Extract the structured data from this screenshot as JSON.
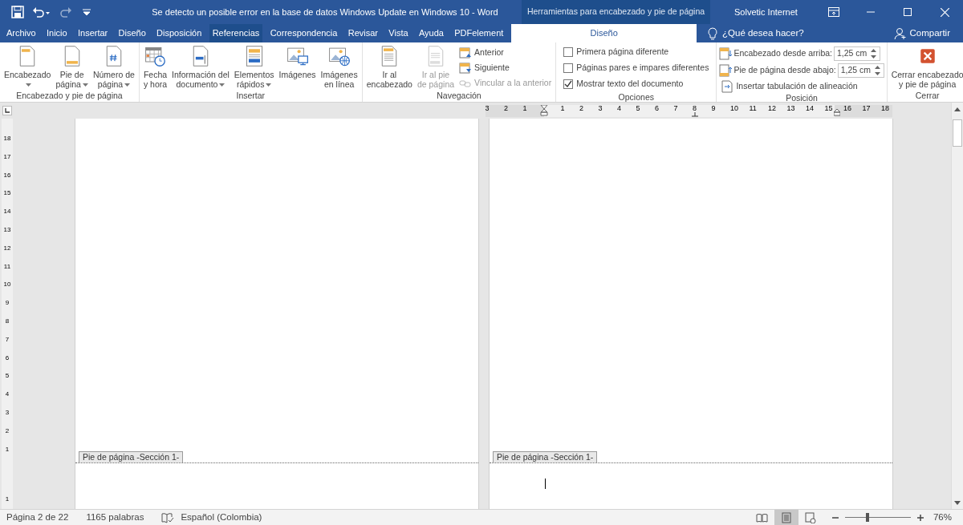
{
  "title_bar": {
    "quick_access": [
      {
        "kind": "save",
        "disabled": false
      },
      {
        "kind": "undo",
        "disabled": false
      },
      {
        "kind": "redo",
        "disabled": true
      },
      {
        "kind": "customize",
        "disabled": false
      }
    ],
    "title": "Se detecto un posible error en la base de datos Windows Update en Windows 10  -  Word",
    "context_title": "Herramientas para encabezado y pie de página",
    "user": "Solvetic Internet"
  },
  "tabs": [
    {
      "label": "Archivo",
      "selected": false,
      "hovered": false,
      "contextual": false
    },
    {
      "label": "Inicio",
      "selected": false,
      "hovered": false,
      "contextual": false
    },
    {
      "label": "Insertar",
      "selected": false,
      "hovered": false,
      "contextual": false
    },
    {
      "label": "Diseño",
      "selected": false,
      "hovered": false,
      "contextual": false
    },
    {
      "label": "Disposición",
      "selected": false,
      "hovered": false,
      "contextual": false
    },
    {
      "label": "Referencias",
      "selected": false,
      "hovered": true,
      "contextual": false
    },
    {
      "label": "Correspondencia",
      "selected": false,
      "hovered": false,
      "contextual": false
    },
    {
      "label": "Revisar",
      "selected": false,
      "hovered": false,
      "contextual": false
    },
    {
      "label": "Vista",
      "selected": false,
      "hovered": false,
      "contextual": false
    },
    {
      "label": "Ayuda",
      "selected": false,
      "hovered": false,
      "contextual": false
    },
    {
      "label": "PDFelement",
      "selected": false,
      "hovered": false,
      "contextual": false
    },
    {
      "label": "Diseño",
      "selected": true,
      "hovered": false,
      "contextual": true
    }
  ],
  "tell_me": {
    "placeholder": "¿Qué desea hacer?"
  },
  "share": "Compartir",
  "ribbon_groups": [
    {
      "label": "Encabezado y pie de página",
      "items": [
        {
          "kind": "large",
          "lines": [
            "Encabezado"
          ],
          "dropdown": true,
          "disabled": false
        },
        {
          "kind": "large",
          "lines": [
            "Pie de",
            "página"
          ],
          "dropdown": true,
          "disabled": false
        },
        {
          "kind": "large",
          "lines": [
            "Número de",
            "página"
          ],
          "dropdown": true,
          "disabled": false
        }
      ]
    },
    {
      "label": "Insertar",
      "items": [
        {
          "kind": "large",
          "lines": [
            "Fecha",
            "y hora"
          ],
          "dropdown": false,
          "disabled": false
        },
        {
          "kind": "large",
          "lines": [
            "Información del",
            "documento"
          ],
          "dropdown": true,
          "disabled": false
        },
        {
          "kind": "large",
          "lines": [
            "Elementos",
            "rápidos"
          ],
          "dropdown": true,
          "disabled": false
        },
        {
          "kind": "large",
          "lines": [
            "Imágenes"
          ],
          "dropdown": false,
          "disabled": false
        },
        {
          "kind": "large",
          "lines": [
            "Imágenes",
            "en línea"
          ],
          "dropdown": false,
          "disabled": false
        }
      ]
    },
    {
      "label": "Navegación",
      "items": [
        {
          "kind": "large",
          "lines": [
            "Ir al",
            "encabezado"
          ],
          "dropdown": false,
          "disabled": false
        },
        {
          "kind": "large",
          "lines": [
            "Ir al pie",
            "de página"
          ],
          "dropdown": false,
          "disabled": true
        },
        {
          "kind": "small",
          "label": "Anterior",
          "disabled": false
        },
        {
          "kind": "small",
          "label": "Siguiente",
          "disabled": false
        },
        {
          "kind": "small",
          "label": "Vincular a la anterior",
          "disabled": true
        }
      ]
    },
    {
      "label": "Opciones",
      "items": [
        {
          "kind": "checkbox",
          "label": "Primera página diferente",
          "checked": false
        },
        {
          "kind": "checkbox",
          "label": "Páginas pares e impares diferentes",
          "checked": false
        },
        {
          "kind": "checkbox",
          "label": "Mostrar texto del documento",
          "checked": true
        }
      ]
    },
    {
      "label": "Posición",
      "items": [
        {
          "kind": "spinner",
          "label": "Encabezado desde arriba:",
          "value": "1,25 cm"
        },
        {
          "kind": "spinner",
          "label": "Pie de página desde abajo:",
          "value": "1,25 cm"
        },
        {
          "kind": "small",
          "label": "Insertar tabulación de alineación",
          "disabled": false
        }
      ]
    },
    {
      "label": "Cerrar",
      "items": [
        {
          "kind": "large",
          "lines": [
            "Cerrar encabezado",
            "y pie de página"
          ],
          "dropdown": false,
          "disabled": false
        }
      ]
    }
  ],
  "horizontal_ruler": [
    "3",
    "2",
    "1",
    "1",
    "2",
    "3",
    "4",
    "5",
    "6",
    "7",
    "8",
    "9",
    "10",
    "11",
    "12",
    "13",
    "14",
    "15",
    "16",
    "17",
    "18"
  ],
  "vertical_ruler": [
    "18",
    "17",
    "16",
    "15",
    "14",
    "13",
    "12",
    "11",
    "10",
    "9",
    "8",
    "7",
    "6",
    "5",
    "4",
    "3",
    "2",
    "1",
    "1"
  ],
  "pages": [
    {
      "footer_label": "Pie de página -Sección 1-",
      "cursor": false
    },
    {
      "footer_label": "Pie de página -Sección 1-",
      "cursor": true
    }
  ],
  "status_bar": {
    "page": "Página 2 de 22",
    "words": "1165 palabras",
    "language": "Español (Colombia)",
    "views": [
      {
        "kind": "read",
        "selected": false
      },
      {
        "kind": "print",
        "selected": true
      },
      {
        "kind": "web",
        "selected": false
      }
    ],
    "zoom": {
      "level": 0.33,
      "reading": "76%"
    }
  }
}
